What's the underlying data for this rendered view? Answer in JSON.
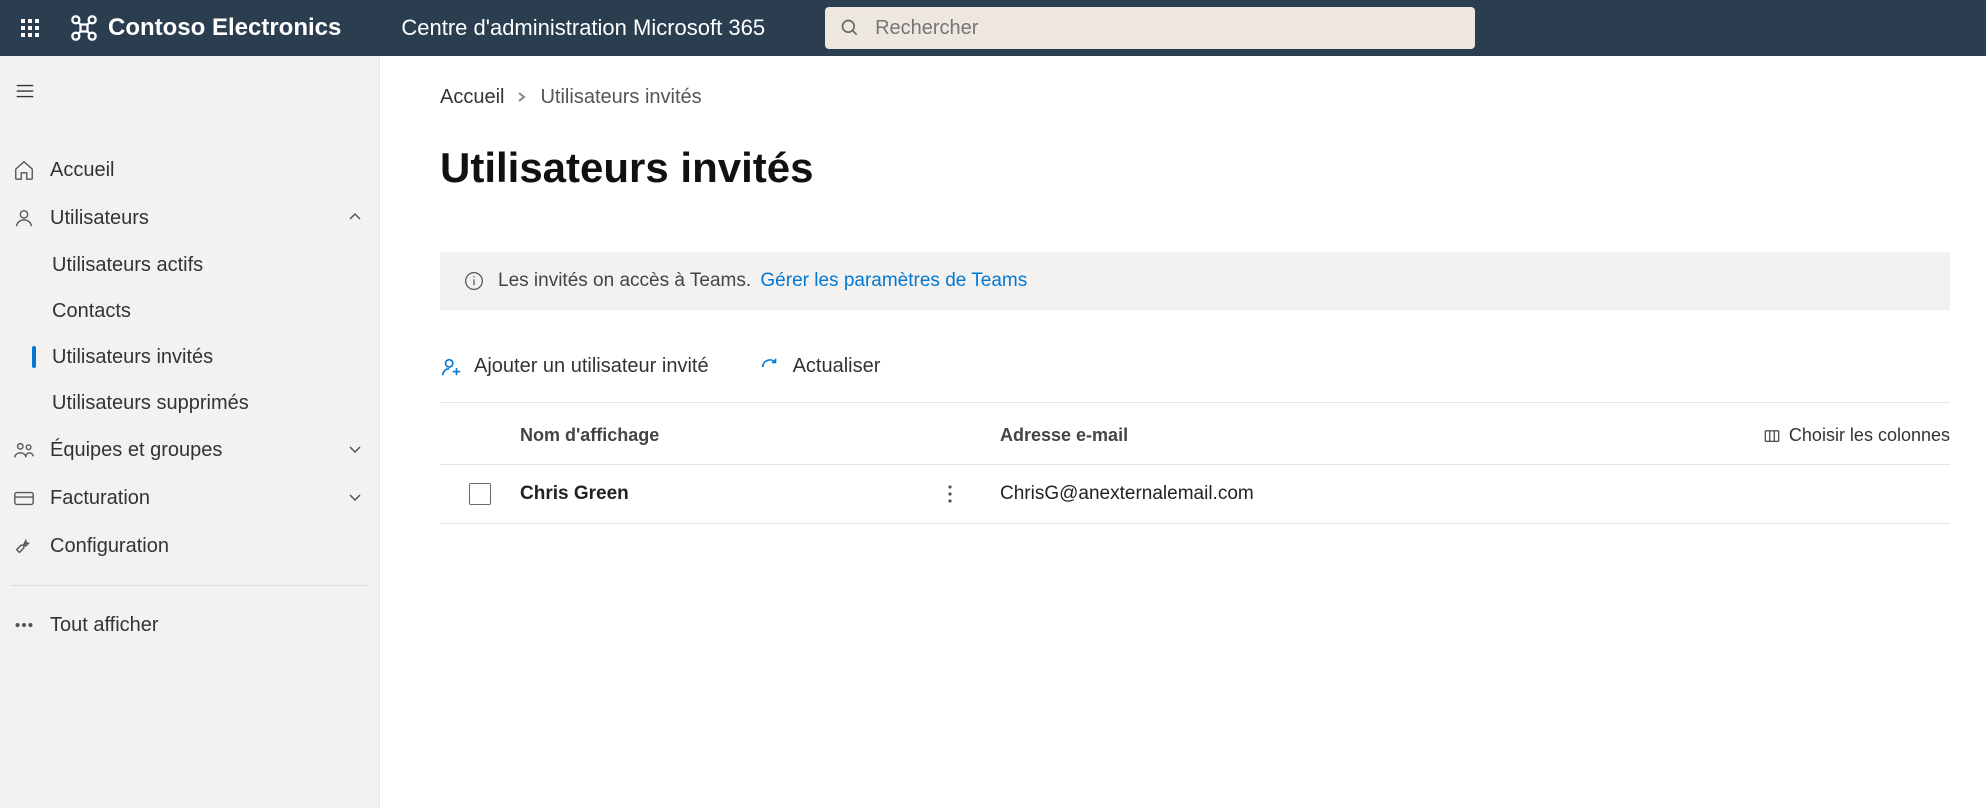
{
  "header": {
    "org_name": "Contoso Electronics",
    "admin_center": "Centre d'administration Microsoft 365",
    "search_placeholder": "Rechercher"
  },
  "sidebar": {
    "items": [
      {
        "icon": "home",
        "label": "Accueil"
      },
      {
        "icon": "user",
        "label": "Utilisateurs",
        "expanded": true,
        "children": [
          {
            "label": "Utilisateurs actifs"
          },
          {
            "label": "Contacts"
          },
          {
            "label": "Utilisateurs invités",
            "active": true
          },
          {
            "label": "Utilisateurs supprimés"
          }
        ]
      },
      {
        "icon": "teams",
        "label": "Équipes et groupes",
        "expanded": false
      },
      {
        "icon": "billing",
        "label": "Facturation",
        "expanded": false
      },
      {
        "icon": "wrench",
        "label": "Configuration"
      }
    ],
    "show_all": "Tout afficher"
  },
  "breadcrumb": {
    "home": "Accueil",
    "current": "Utilisateurs invités"
  },
  "page_title": "Utilisateurs invités",
  "banner": {
    "text": "Les invités on accès à Teams.",
    "link": "Gérer les paramètres de Teams"
  },
  "toolbar": {
    "add_guest": "Ajouter un utilisateur invité",
    "refresh": "Actualiser"
  },
  "table": {
    "columns": {
      "name": "Nom d'affichage",
      "email": "Adresse e-mail"
    },
    "choose_columns": "Choisir les colonnes",
    "rows": [
      {
        "name": "Chris Green",
        "email": "ChrisG@anexternalemail.com"
      }
    ]
  }
}
